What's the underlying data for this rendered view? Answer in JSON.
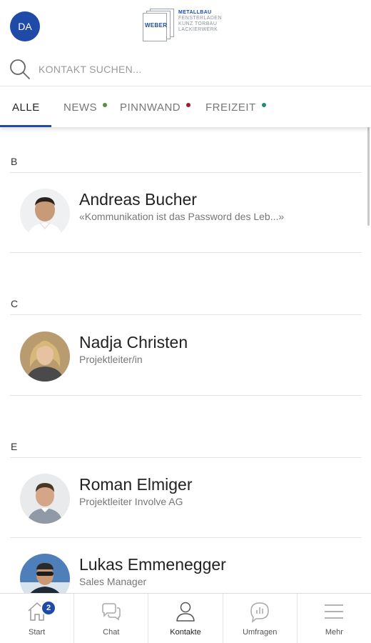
{
  "header": {
    "user_initials": "DA",
    "logo": {
      "brand": "WEBER",
      "lines": [
        "METALLBAU",
        "FENSTERLADEN",
        "KUNZ TORBAU",
        "LACKIERWERK"
      ]
    }
  },
  "search": {
    "placeholder": "KONTAKT SUCHEN..."
  },
  "tabs": [
    {
      "label": "ALLE",
      "active": true
    },
    {
      "label": "NEWS",
      "dot_color": "#5a8f3c"
    },
    {
      "label": "PINNWAND",
      "dot_color": "#9b1c2a"
    },
    {
      "label": "FREIZEIT",
      "dot_color": "#1d8f73"
    }
  ],
  "sections": [
    {
      "letter": "B",
      "contacts": [
        {
          "name": "Andreas Bucher",
          "subtitle": "«Kommunikation ist das Password des Leb...»"
        }
      ]
    },
    {
      "letter": "C",
      "contacts": [
        {
          "name": "Nadja Christen",
          "subtitle": "Projektleiter/in"
        }
      ]
    },
    {
      "letter": "E",
      "contacts": [
        {
          "name": "Roman Elmiger",
          "subtitle": "Projektleiter Involve AG"
        },
        {
          "name": "Lukas Emmenegger",
          "subtitle": "Sales Manager"
        }
      ]
    }
  ],
  "bottom_nav": [
    {
      "label": "Start",
      "icon": "home-icon",
      "badge": "2"
    },
    {
      "label": "Chat",
      "icon": "chat-icon"
    },
    {
      "label": "Kontakte",
      "icon": "person-icon",
      "active": true
    },
    {
      "label": "Umfragen",
      "icon": "poll-icon"
    },
    {
      "label": "Mehr",
      "icon": "menu-icon"
    }
  ],
  "colors": {
    "accent": "#1f4aa8"
  }
}
